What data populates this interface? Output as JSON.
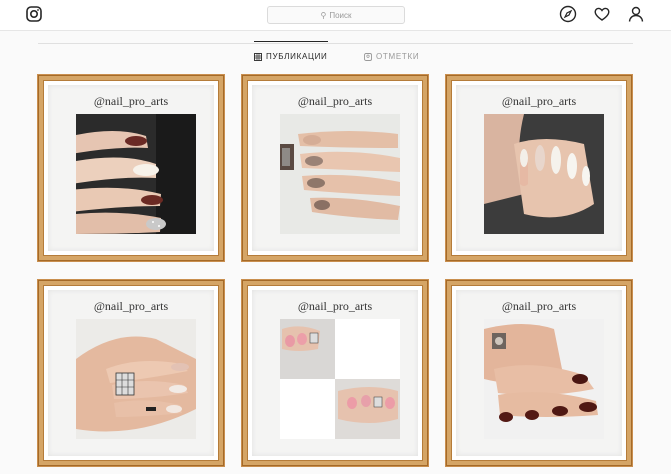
{
  "header": {
    "logo_icon": "instagram-icon",
    "search_placeholder": "Поиск",
    "icons": [
      "compass-icon",
      "heart-icon",
      "profile-icon"
    ]
  },
  "tabs": [
    {
      "label": "ПУБЛИКАЦИИ",
      "icon": "grid-icon",
      "active": true
    },
    {
      "label": "ОТМЕТКИ",
      "icon": "tag-icon",
      "active": false
    }
  ],
  "posts": [
    {
      "handle": "@nail_pro_arts",
      "image": "nails-burgundy-white-glitter"
    },
    {
      "handle": "@nail_pro_arts",
      "image": "nails-beige-watch"
    },
    {
      "handle": "@nail_pro_arts",
      "image": "nails-white-almond"
    },
    {
      "handle": "@nail_pro_arts",
      "image": "nails-nude-pattern"
    },
    {
      "handle": "@nail_pro_arts",
      "image": "nails-collage-pink"
    },
    {
      "handle": "@nail_pro_arts",
      "image": "nails-dark-burgundy"
    }
  ],
  "colors": {
    "frame": "#d5a566",
    "mat": "#f4f4f3",
    "background": "#fafafa"
  }
}
